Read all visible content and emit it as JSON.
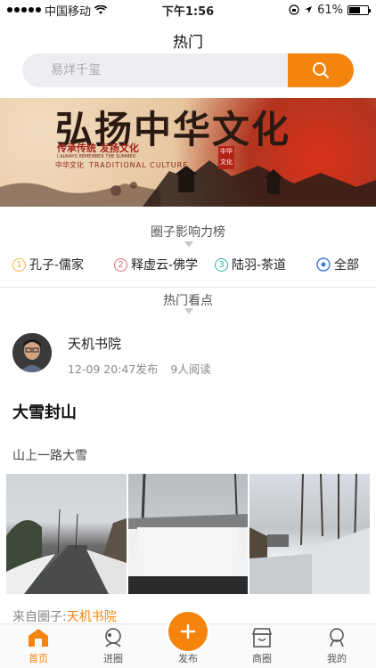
{
  "status_bar": {
    "carrier": "中国移动",
    "time": "下午1:56",
    "battery": "61%",
    "battery_level": 0.61
  },
  "header": {
    "title": "热门",
    "search_placeholder": "易烊千玺"
  },
  "banner": {
    "title": "弘扬中华文化",
    "subtitle": "传承传统 发扬文化",
    "subtitle_en": "I ALWAYS REMEMBER THE SUMMER",
    "tag": "中华文化",
    "tag_en": "TRADITIONAL CULTURE",
    "seal": "中华 文化"
  },
  "ranking": {
    "label": "圈子影响力榜",
    "items": [
      {
        "num": "1",
        "label": "孔子-儒家",
        "color": "#f2b544"
      },
      {
        "num": "2",
        "label": "释虚云-佛学",
        "color": "#e5677e"
      },
      {
        "num": "3",
        "label": "陆羽-茶道",
        "color": "#2bb7a4"
      }
    ],
    "all_label": "全部"
  },
  "hot": {
    "label": "热门看点"
  },
  "post": {
    "author": "天机书院",
    "date": "12-09 20:47发布",
    "reads": "9人阅读",
    "title": "大雪封山",
    "body": "山上一路大雪",
    "from_prefix": "来自圈子:",
    "from_circle": "天机书院"
  },
  "tabbar": {
    "home": "首页",
    "circles": "进圈",
    "publish": "发布",
    "shop": "商圈",
    "me": "我的"
  },
  "colors": {
    "accent": "#f5840c"
  }
}
